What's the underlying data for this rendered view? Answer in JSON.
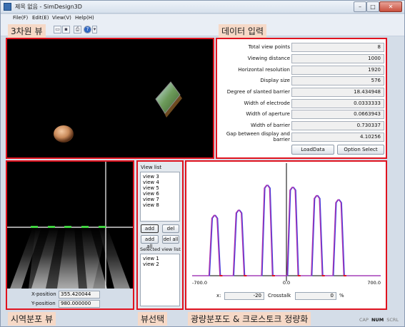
{
  "window": {
    "title": "제목 없음 - SimDesign3D",
    "min": "–",
    "max": "□",
    "close": "✕"
  },
  "menu": [
    "File(F)",
    "Edit(E)",
    "View(V)",
    "Help(H)"
  ],
  "overlays": {
    "view3d": "3차원 뷰",
    "data_input": "데이터 입력",
    "field_dist": "시역분포 뷰",
    "view_select": "뷰선택",
    "luminance": "광량분포도 & 크로스토크 정량화"
  },
  "form": {
    "rows": [
      {
        "label": "Total view points",
        "value": "8"
      },
      {
        "label": "Viewing distance",
        "value": "1000"
      },
      {
        "label": "Horizontal resolution",
        "value": "1920"
      },
      {
        "label": "Display size",
        "value": "576"
      },
      {
        "label": "Degree of slanted barrier",
        "value": "18.434948"
      },
      {
        "label": "Width of electrode",
        "value": "0.0333333"
      },
      {
        "label": "Width of aperture",
        "value": "0.0663943"
      },
      {
        "label": "Width of barrier",
        "value": "0.730337"
      },
      {
        "label": "Gap between display and barrier",
        "value": "4.10256"
      }
    ],
    "load_btn": "LoadData",
    "option_btn": "Option Select"
  },
  "viewlist": {
    "label": "View list",
    "items": [
      "view   3",
      "view   4",
      "view   5",
      "view   6",
      "view   7",
      "view   8"
    ],
    "add": "add",
    "del": "del",
    "add_all": "add all",
    "del_all": "del all",
    "selected_label": "Selected view list",
    "selected_items": [
      "view   1",
      "view   2"
    ]
  },
  "field": {
    "x_label": "X-position",
    "x_value": "355.420044",
    "y_label": "Y-position",
    "y_value": "980.000000"
  },
  "chart_data": {
    "type": "line",
    "x_ticks": [
      "-700.0",
      "0.0",
      "700.0"
    ],
    "xlim": [
      -700,
      700
    ],
    "series": [
      {
        "color": "#3f3fe0",
        "peaks": [
          -560,
          -380,
          -170,
          20,
          200,
          360
        ]
      },
      {
        "color": "#b034b0",
        "peaks": [
          -565,
          -385,
          -175,
          15,
          195,
          355
        ]
      }
    ]
  },
  "bottom": {
    "x_label": "x:",
    "x_value": "-20",
    "crosstalk_label": "Crosstalk",
    "crosstalk_value": "0",
    "crosstalk_unit": "%"
  },
  "status": {
    "cap": "CAP",
    "num": "NUM",
    "scrl": "SCRL"
  }
}
